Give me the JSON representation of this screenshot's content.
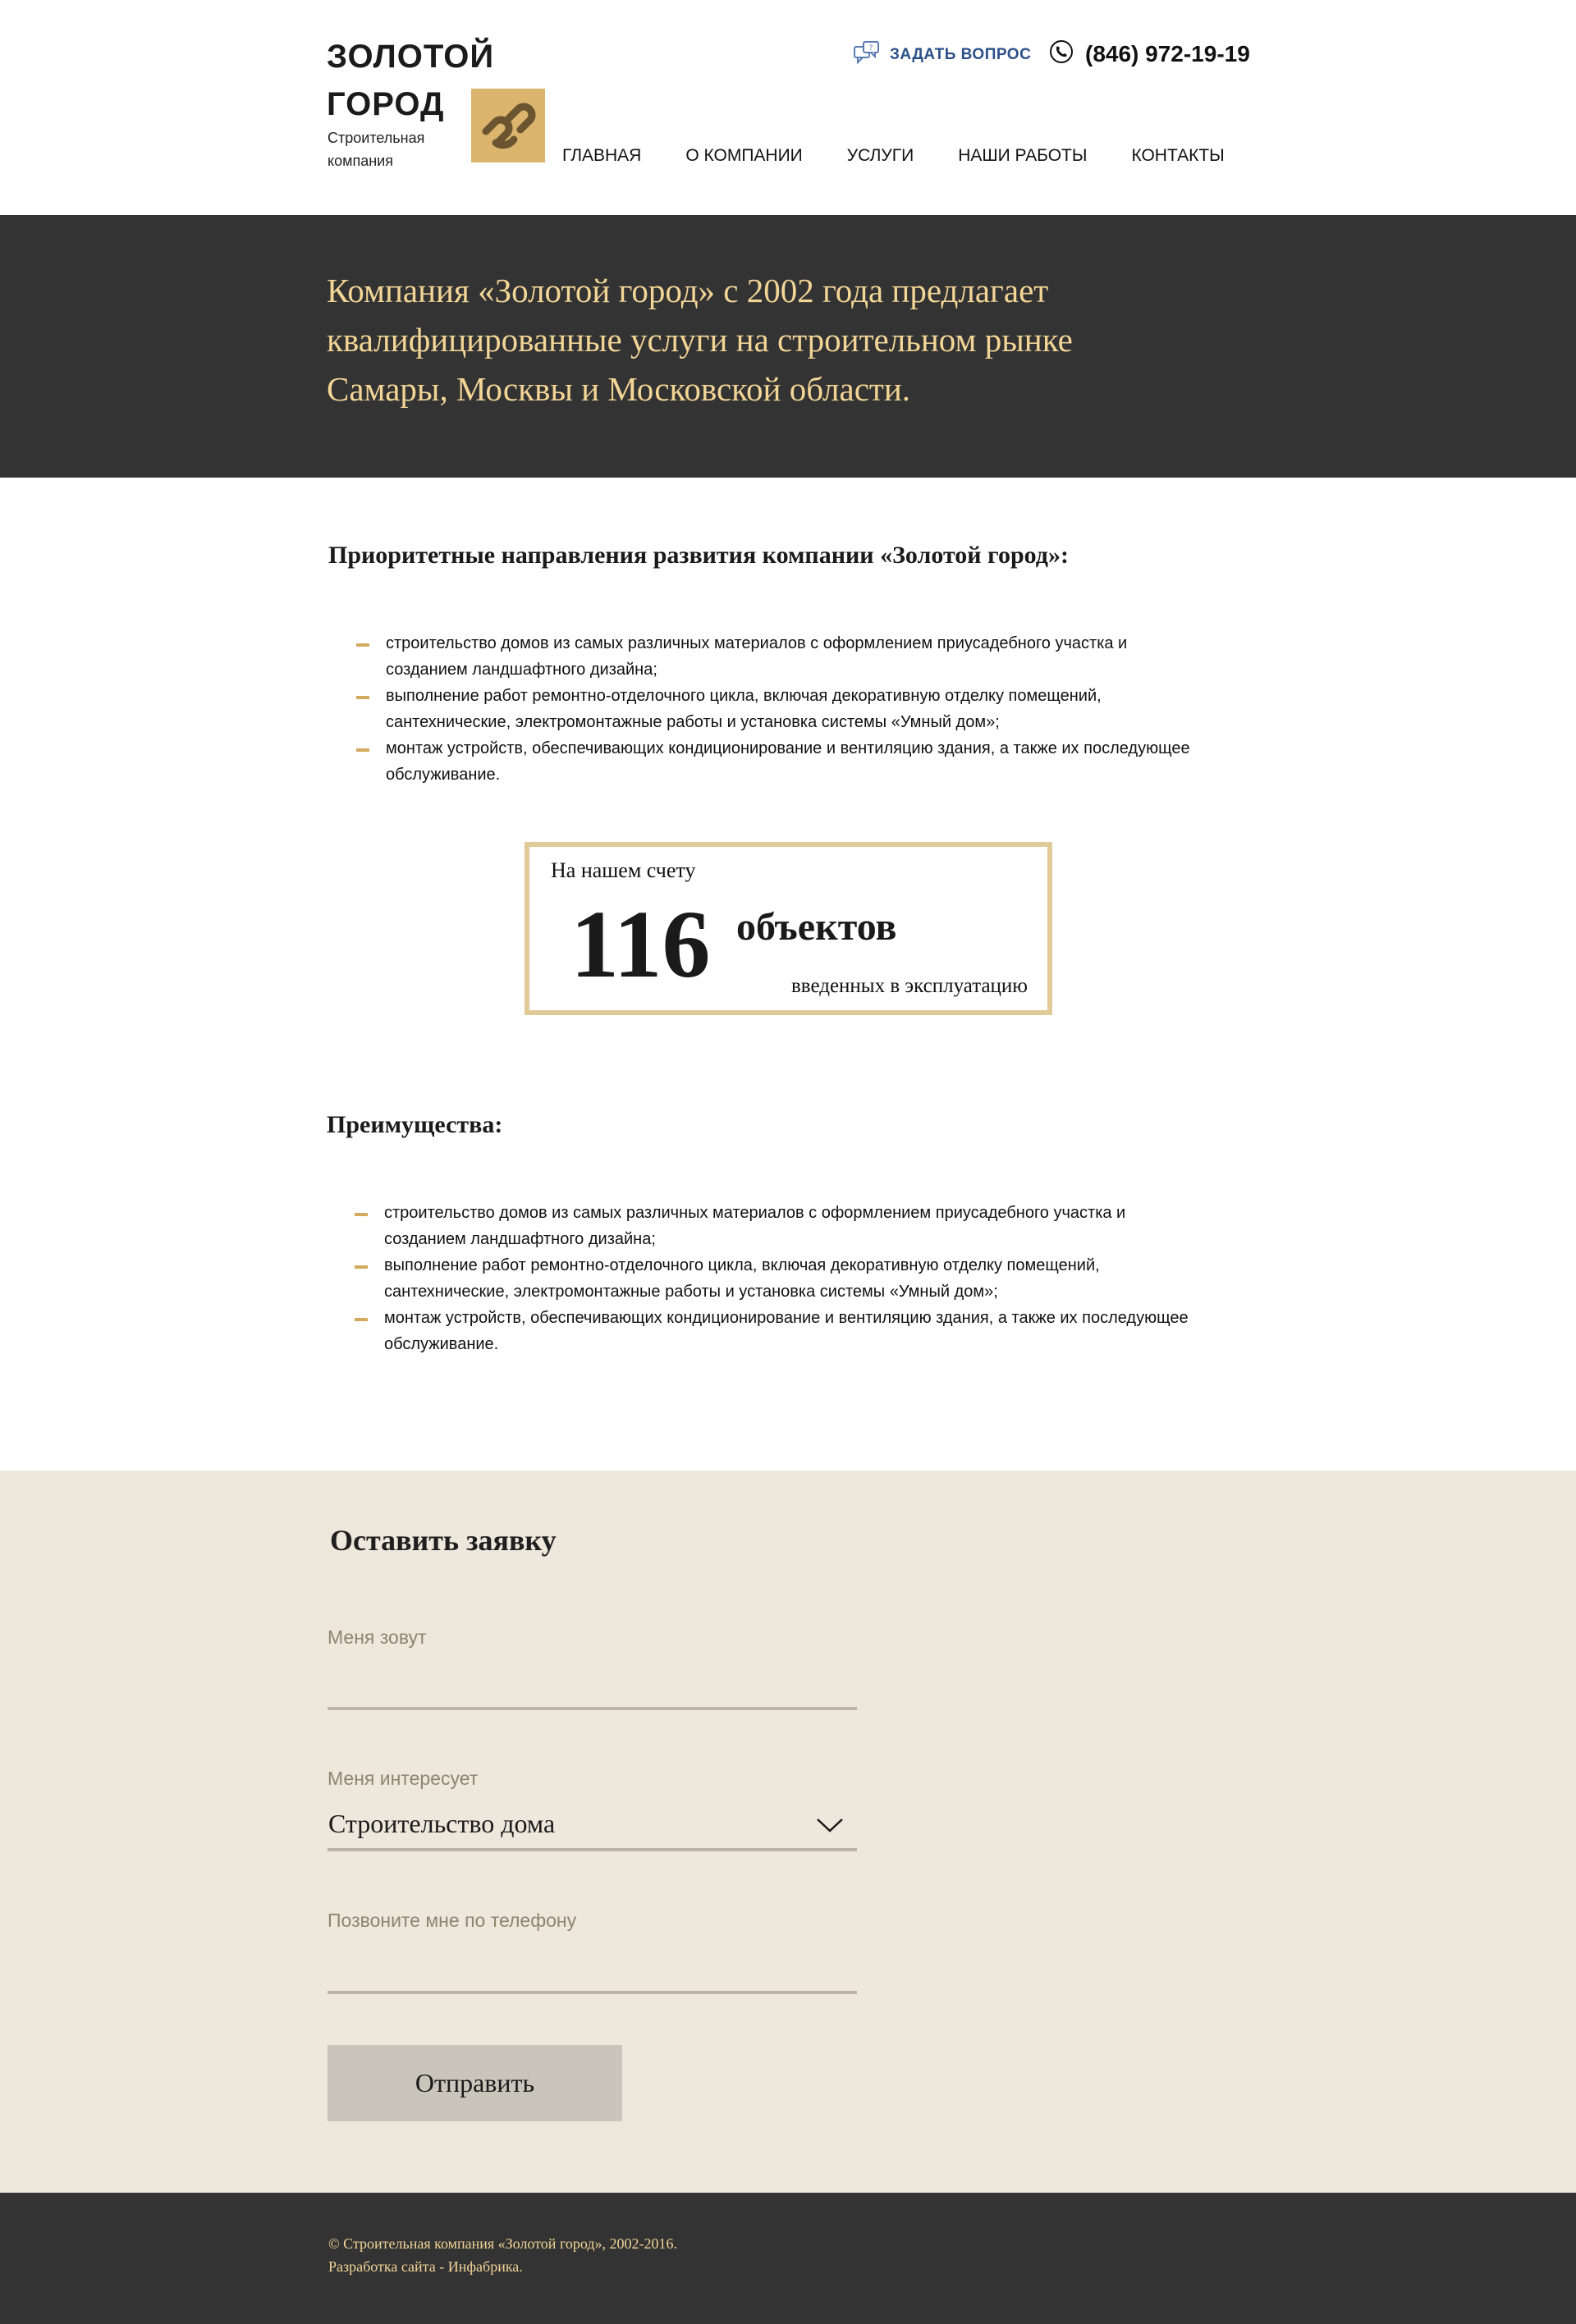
{
  "header": {
    "logo_title_line1": "ЗОЛОТОЙ",
    "logo_title_line2": "ГОРОД",
    "logo_sub_line1": "Строительная",
    "logo_sub_line2": "компания",
    "ask_label": "ЗАДАТЬ ВОПРОС",
    "phone": "(846) 972-19-19",
    "nav": [
      "ГЛАВНАЯ",
      "О КОМПАНИИ",
      "УСЛУГИ",
      "НАШИ РАБОТЫ",
      "КОНТАКТЫ"
    ]
  },
  "hero": {
    "text": "Компания «Золотой город» с 2002 года предлагает квалифицированные услуги на строительном рынке Самары, Москвы и Московской области."
  },
  "priorities": {
    "heading": "Приоритетные направления развития компании «Золотой город»:",
    "items": [
      "строительство домов из самых различных материалов с оформлением приусадебного участка и созданием ландшафтного дизайна;",
      "выполнение работ ремонтно-отделочного цикла, включая декоративную отделку помещений, сантехнические, электромонтажные работы и установка системы «Умный дом»;",
      "монтаж устройств, обеспечивающих кондиционирование и вентиляцию здания, а также их последующее обслуживание."
    ]
  },
  "counter": {
    "top": "На нашем счету",
    "number": "116",
    "unit": "объектов",
    "bottom": "введенных в эксплуатацию"
  },
  "advantages": {
    "heading": "Преимущества:",
    "items": [
      "строительство домов из самых различных материалов с оформлением приусадебного участка и созданием ландшафтного дизайна;",
      "выполнение работ ремонтно-отделочного цикла, включая декоративную отделку помещений, сантехнические, электромонтажные работы и установка системы «Умный дом»;",
      "монтаж устройств, обеспечивающих кондиционирование и вентиляцию здания, а также их последующее обслуживание."
    ]
  },
  "form": {
    "title": "Оставить заявку",
    "name_label": "Меня зовут",
    "name_value": "",
    "interest_label": "Меня интересует",
    "interest_value": "Строительство дома",
    "phone_label": "Позвоните мне по телефону",
    "phone_value": "",
    "submit_label": "Отправить"
  },
  "footer": {
    "line1": "© Строительная компания «Золотой город», 2002-2016.",
    "line2": "Разработка сайта - Инфабрика."
  },
  "colors": {
    "accent_gold": "#dbb46d",
    "hero_text": "#f3d596",
    "dark_bg": "#333333",
    "form_bg": "#eee7dc",
    "link_blue": "#2c4f8a"
  }
}
